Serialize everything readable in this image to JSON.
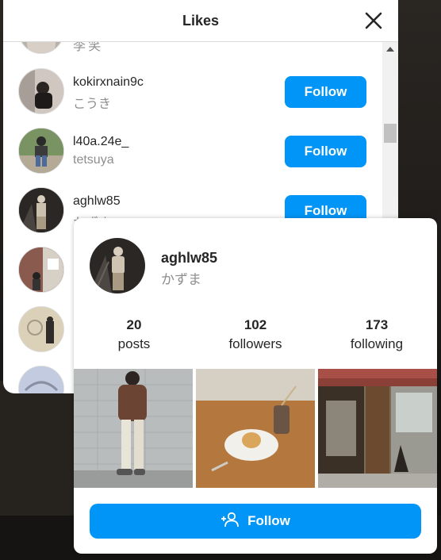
{
  "modal": {
    "title": "Likes"
  },
  "likes": [
    {
      "username": "",
      "fullname": "李 笑",
      "button": ""
    },
    {
      "username": "kokirxnain9c",
      "fullname": "こうき",
      "button": "Follow"
    },
    {
      "username": "l40a.24e_",
      "fullname": "tetsuya",
      "button": "Follow"
    },
    {
      "username": "aghlw85",
      "fullname": "かずま",
      "button": "Follow"
    }
  ],
  "card": {
    "username": "aghlw85",
    "fullname": "かずま",
    "stats": [
      {
        "value": "20",
        "label": "posts"
      },
      {
        "value": "102",
        "label": "followers"
      },
      {
        "value": "173",
        "label": "following"
      }
    ],
    "follow_label": "Follow"
  },
  "icons": {
    "close": "close-icon",
    "add_user": "person-add-icon"
  },
  "colors": {
    "accent": "#0095f6",
    "secondary_text": "#8e8e8e",
    "primary_text": "#262626"
  }
}
